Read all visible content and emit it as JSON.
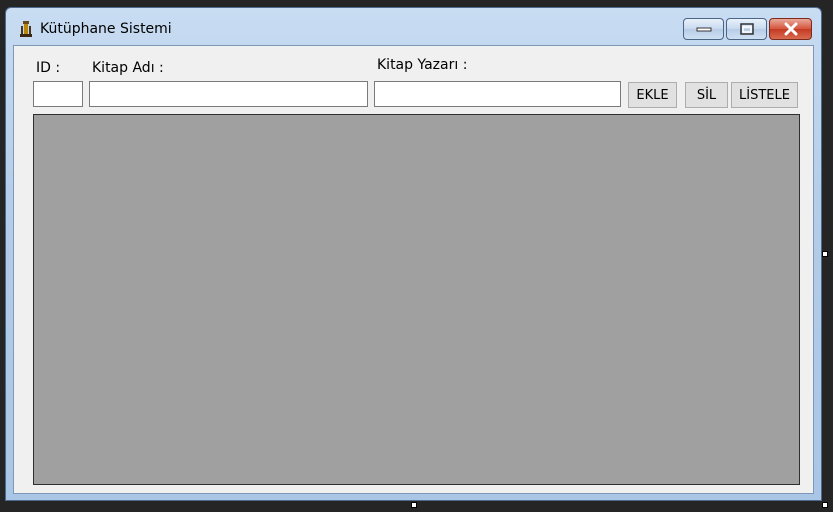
{
  "window": {
    "title": "Kütüphane Sistemi",
    "icon": "book-stand-icon",
    "controls": {
      "minimize_icon": "minimize-icon",
      "maximize_icon": "maximize-icon",
      "close_icon": "close-icon"
    }
  },
  "form": {
    "id_label": "ID :",
    "name_label": "Kitap Adı :",
    "author_label": "Kitap Yazarı :",
    "id_value": "",
    "name_value": "",
    "author_value": "",
    "add_button": "EKLE",
    "delete_button": "SİL",
    "list_button": "LİSTELE"
  },
  "grid": {
    "background": "#a0a0a0",
    "rows": []
  },
  "colors": {
    "client_bg": "#f0f0f0",
    "close_button": "#c43a22"
  }
}
